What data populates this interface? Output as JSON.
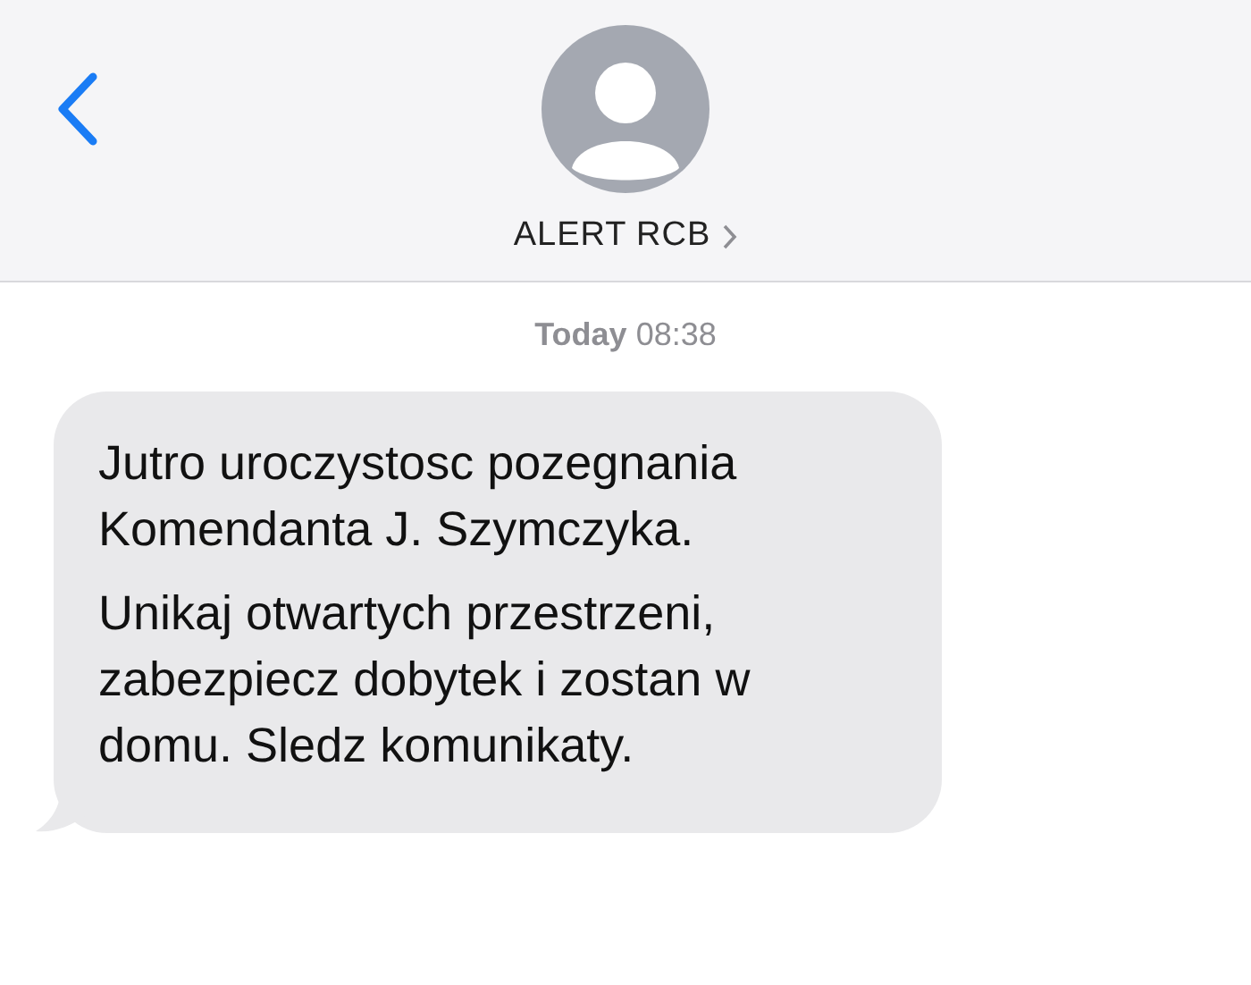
{
  "header": {
    "contact_name": "ALERT RCB"
  },
  "timestamp": {
    "day": "Today",
    "time": "08:38"
  },
  "messages": [
    {
      "kind": "incoming",
      "paragraphs": [
        "Jutro uroczystosc pozegnania Komendanta J. Szymczyka.",
        "Unikaj otwartych przestrzeni, zabezpiecz dobytek i zostan w domu. Sledz komunikaty."
      ]
    }
  ]
}
